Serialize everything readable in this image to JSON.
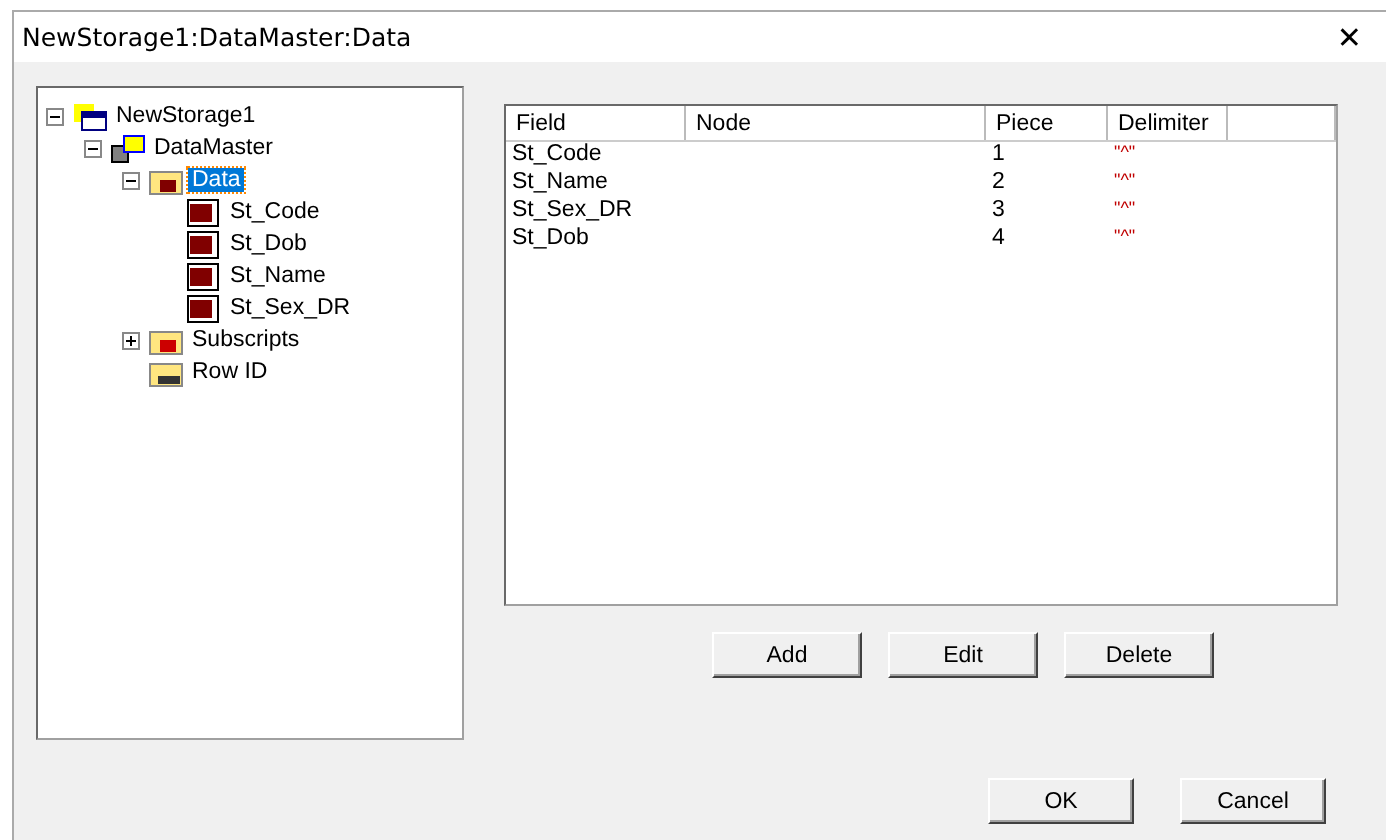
{
  "window": {
    "title": "NewStorage1:DataMaster:Data",
    "close": "✕"
  },
  "tree": [
    {
      "label": "NewStorage1",
      "kind": "storage",
      "expanded": true,
      "selected": false,
      "children": [
        {
          "label": "DataMaster",
          "kind": "master",
          "expanded": true,
          "selected": false,
          "children": [
            {
              "label": "Data",
              "kind": "data",
              "expanded": true,
              "selected": true,
              "children": [
                {
                  "label": "St_Code",
                  "kind": "field",
                  "selected": false
                },
                {
                  "label": "St_Dob",
                  "kind": "field",
                  "selected": false
                },
                {
                  "label": "St_Name",
                  "kind": "field",
                  "selected": false
                },
                {
                  "label": "St_Sex_DR",
                  "kind": "field",
                  "selected": false
                }
              ]
            },
            {
              "label": "Subscripts",
              "kind": "subscripts",
              "expanded": false,
              "selected": false
            },
            {
              "label": "Row ID",
              "kind": "rowid",
              "selected": false
            }
          ]
        }
      ]
    }
  ],
  "table": {
    "columns": [
      "Field",
      "Node",
      "Piece",
      "Delimiter"
    ],
    "rows": [
      [
        "St_Code",
        "",
        "1",
        "\"^\""
      ],
      [
        "St_Name",
        "",
        "2",
        "\"^\""
      ],
      [
        "St_Sex_DR",
        "",
        "3",
        "\"^\""
      ],
      [
        "St_Dob",
        "",
        "4",
        "\"^\""
      ]
    ]
  },
  "actions": [
    "Add",
    "Edit",
    "Delete"
  ],
  "buttons": [
    "OK",
    "Cancel"
  ]
}
